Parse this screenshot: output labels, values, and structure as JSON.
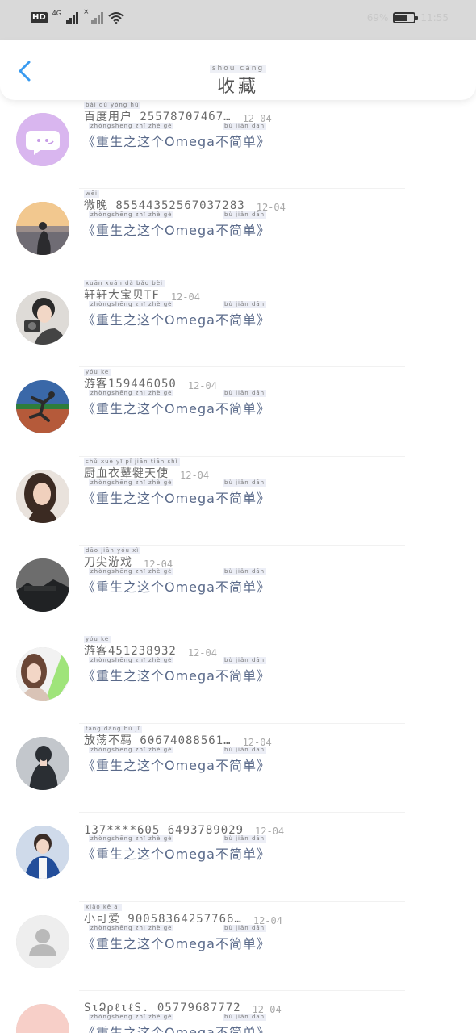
{
  "status_bar": {
    "hd_label": "HD",
    "net_label": "4G",
    "x_label": "×",
    "battery_percent_text": "69%",
    "battery_level": 0.69,
    "time": "11:55"
  },
  "header": {
    "title_pinyin": "shōu cáng",
    "title": "收藏",
    "back_icon": "chevron-left-icon",
    "accent_color": "#3a9bf0"
  },
  "items": [
    {
      "name_pinyin": "bǎi dù yòng hù",
      "name": "百度用户_255787074б7…",
      "date": "12-04",
      "fic_pinyin_a": "zhòngshēng zhī zhè gè",
      "fic_pinyin_b": "bù  jiǎn dān",
      "fic": "《重生之这个Omega不简单》",
      "avatar": "chat-bubble-icon"
    },
    {
      "name_pinyin": "wēi",
      "name": "微晚_85544352567037283",
      "date": "12-04",
      "fic_pinyin_a": "zhòngshēng zhī zhè gè",
      "fic_pinyin_b": "bù  jiǎn dān",
      "fic": "《重生之这个Omega不简单》",
      "avatar": "sunset-photo"
    },
    {
      "name_pinyin": "xuān xuān dà bǎo bèi",
      "name": "轩轩大宝贝TF",
      "date": "12-04",
      "fic_pinyin_a": "zhòngshēng zhī zhè gè",
      "fic_pinyin_b": "bù  jiǎn dān",
      "fic": "《重生之这个Omega不简单》",
      "avatar": "camera-girl-photo"
    },
    {
      "name_pinyin": "yóu kè",
      "name": "游客159446050",
      "date": "12-04",
      "fic_pinyin_a": "zhòngshēng zhī zhè gè",
      "fic_pinyin_b": "bù  jiǎn dān",
      "fic": "《重生之这个Omega不简单》",
      "avatar": "runner-photo"
    },
    {
      "name_pinyin": "chǔ xuè yī pǐ jiān tiān shǐ",
      "name": "厨血衣鼙犍天使",
      "date": "12-04",
      "fic_pinyin_a": "zhòngshēng zhī zhè gè",
      "fic_pinyin_b": "bù  jiǎn dān",
      "fic": "《重生之这个Omega不简单》",
      "avatar": "portrait-photo"
    },
    {
      "name_pinyin": "dāo jiān yóu xì",
      "name": "刀尖游戏",
      "date": "12-04",
      "fic_pinyin_a": "zhòngshēng zhī zhè gè",
      "fic_pinyin_b": "bù  jiǎn dān",
      "fic": "《重生之这个Omega不简单》",
      "avatar": "dark-landscape-photo"
    },
    {
      "name_pinyin": "yóu kè",
      "name": "游客451238932",
      "date": "12-04",
      "fic_pinyin_a": "zhòngshēng zhī zhè gè",
      "fic_pinyin_b": "bù  jiǎn dān",
      "fic": "《重生之这个Omega不简单》",
      "avatar": "girl-green-photo"
    },
    {
      "name_pinyin": "fàng dàng bù jī",
      "name": "放荡不羁_60674088561…",
      "date": "12-04",
      "fic_pinyin_a": "zhòngshēng zhī zhè gè",
      "fic_pinyin_b": "bù  jiǎn dān",
      "fic": "《重生之这个Omega不简单》",
      "avatar": "figure-photo"
    },
    {
      "name_pinyin": "",
      "name": "137****605_6493789029",
      "date": "12-04",
      "fic_pinyin_a": "zhòngshēng zhī zhè gè",
      "fic_pinyin_b": "bù  jiǎn dān",
      "fic": "《重生之这个Omega不简单》",
      "avatar": "boy-photo"
    },
    {
      "name_pinyin": "xiǎo kě ài",
      "name": "小可爱_90058364257766…",
      "date": "12-04",
      "fic_pinyin_a": "zhòngshēng zhī zhè gè",
      "fic_pinyin_b": "bù  jiǎn dān",
      "fic": "《重生之这个Omega不简单》",
      "avatar": "default-user-icon"
    },
    {
      "name_pinyin": "",
      "name": "SιՁρℓιℓS._05779687772",
      "date": "12-04",
      "fic_pinyin_a": "zhòngshēng zhī zhè gè",
      "fic_pinyin_b": "bù  jiǎn dān",
      "fic": "《重生之这个Omega不简单》",
      "avatar": "pink-photo"
    }
  ]
}
